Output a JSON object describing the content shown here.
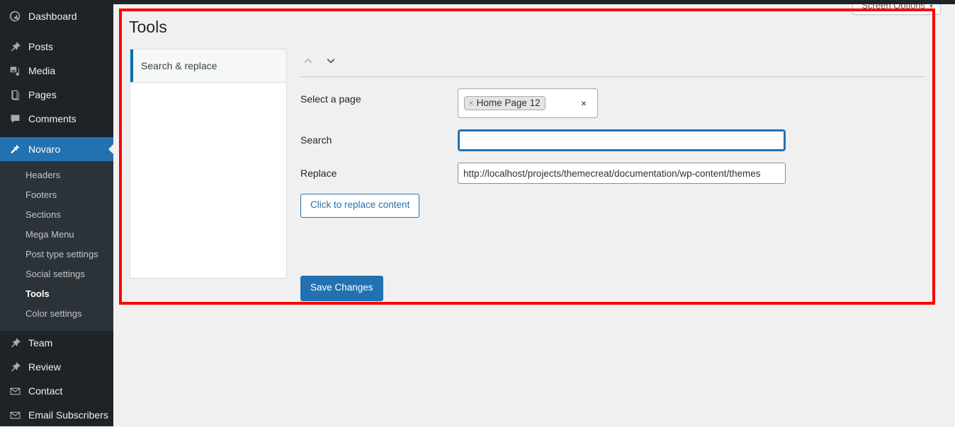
{
  "screen_options": {
    "label": "Screen Options",
    "caret": "▾"
  },
  "sidebar": {
    "items": [
      {
        "label": "Dashboard",
        "icon": "dashboard-icon",
        "current": false
      },
      {
        "label": "Posts",
        "icon": "pin-icon",
        "current": false
      },
      {
        "label": "Media",
        "icon": "media-icon",
        "current": false
      },
      {
        "label": "Pages",
        "icon": "pages-icon",
        "current": false
      },
      {
        "label": "Comments",
        "icon": "comments-icon",
        "current": false
      },
      {
        "label": "Novaro",
        "icon": "hammer-icon",
        "current": true
      },
      {
        "label": "Team",
        "icon": "pin-icon",
        "current": false
      },
      {
        "label": "Review",
        "icon": "pin-icon",
        "current": false
      },
      {
        "label": "Contact",
        "icon": "envelope-icon",
        "current": false
      },
      {
        "label": "Email Subscribers",
        "icon": "envelope-icon",
        "current": false
      }
    ],
    "submenu": [
      {
        "label": "Headers",
        "active": false
      },
      {
        "label": "Footers",
        "active": false
      },
      {
        "label": "Sections",
        "active": false
      },
      {
        "label": "Mega Menu",
        "active": false
      },
      {
        "label": "Post type settings",
        "active": false
      },
      {
        "label": "Social settings",
        "active": false
      },
      {
        "label": "Tools",
        "active": true
      },
      {
        "label": "Color settings",
        "active": false
      }
    ]
  },
  "page": {
    "title": "Tools"
  },
  "tab_panel": {
    "tab_label": "Search & replace"
  },
  "form": {
    "sorter": {
      "up_icon": "chevron-up-icon",
      "down_icon": "chevron-down-icon"
    },
    "select_page": {
      "label": "Select a page",
      "selected_tag": "Home Page 12",
      "tag_remove": "×",
      "clear": "×"
    },
    "search": {
      "label": "Search",
      "value": "",
      "placeholder": ""
    },
    "replace": {
      "label": "Replace",
      "value": "http://localhost/projects/themecreat/documentation/wp-content/themes",
      "placeholder": ""
    },
    "replace_button": "Click to replace content",
    "save_button": "Save Changes"
  },
  "colors": {
    "accent": "#2271b1",
    "sidebar_bg": "#1d2327",
    "submenu_bg": "#2c3338",
    "page_bg": "#f0f0f1",
    "highlight": "#ff0000",
    "tab_accent": "#0073aa"
  }
}
